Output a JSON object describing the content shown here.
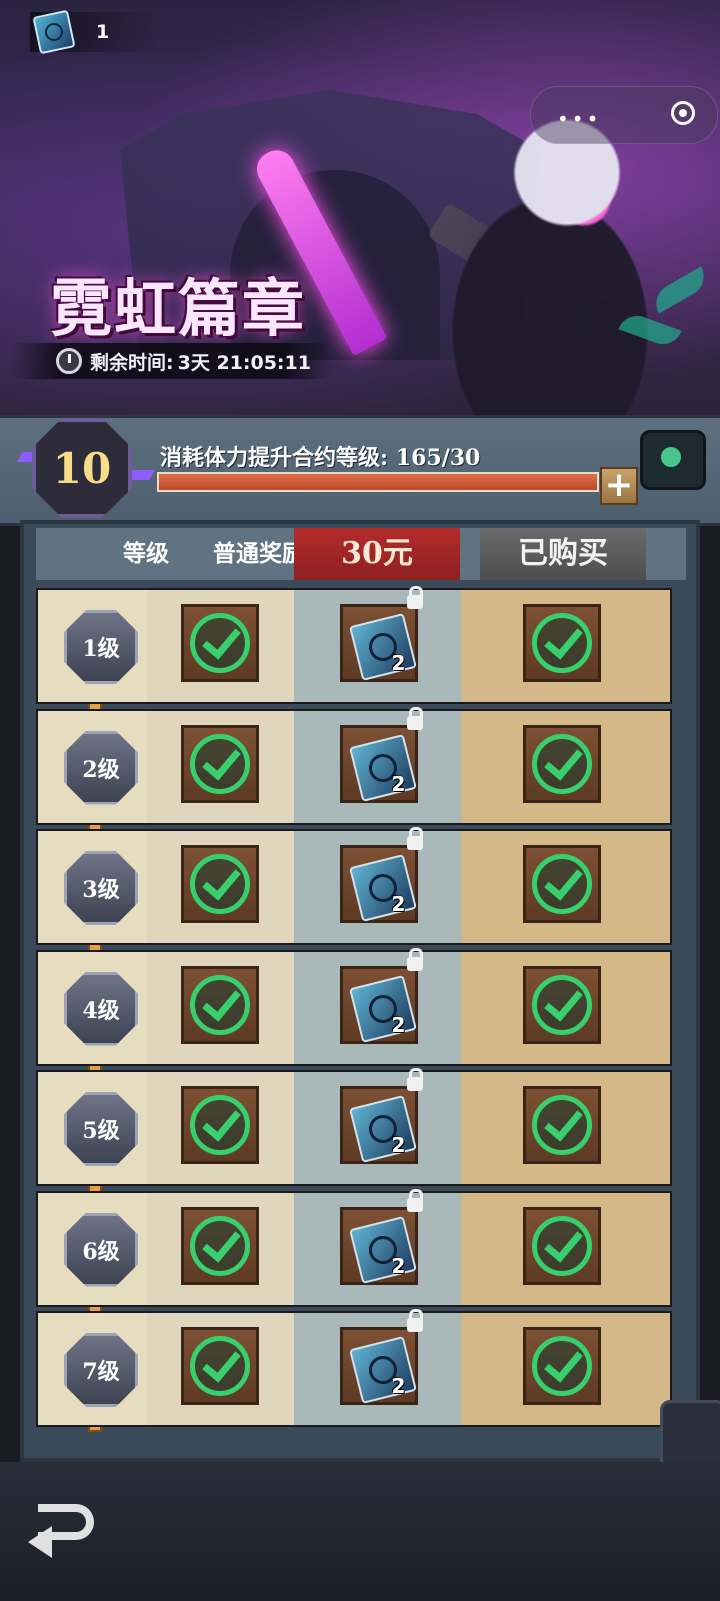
{
  "top_counter": {
    "icon": "book-icon",
    "value": "1"
  },
  "title": "霓虹篇章",
  "timer": {
    "label": "剩余时间:",
    "value": "3天 21:05:11"
  },
  "contract": {
    "level": "10",
    "label": "消耗体力提升合约等级: 165/30",
    "progress": 1.0
  },
  "table_header": {
    "level": "等级",
    "normal_reward": "普通奖励",
    "paid_price": "30元",
    "bought": "已购买"
  },
  "rows": [
    {
      "level": "1级",
      "normal": "claimed",
      "premium_qty": "2",
      "premium_locked": true,
      "bought": "claimed"
    },
    {
      "level": "2级",
      "normal": "claimed",
      "premium_qty": "2",
      "premium_locked": true,
      "bought": "claimed"
    },
    {
      "level": "3级",
      "normal": "claimed",
      "premium_qty": "2",
      "premium_locked": true,
      "bought": "claimed"
    },
    {
      "level": "4级",
      "normal": "claimed",
      "premium_qty": "2",
      "premium_locked": true,
      "bought": "claimed"
    },
    {
      "level": "5级",
      "normal": "claimed",
      "premium_qty": "2",
      "premium_locked": true,
      "bought": "claimed"
    },
    {
      "level": "6级",
      "normal": "claimed",
      "premium_qty": "2",
      "premium_locked": true,
      "bought": "claimed"
    },
    {
      "level": "7级",
      "normal": "claimed",
      "premium_qty": "2",
      "premium_locked": true,
      "bought": "claimed"
    }
  ],
  "colors": {
    "accent": "#b52c2c",
    "claimed": "#37d06c",
    "track": "#e7a043"
  }
}
